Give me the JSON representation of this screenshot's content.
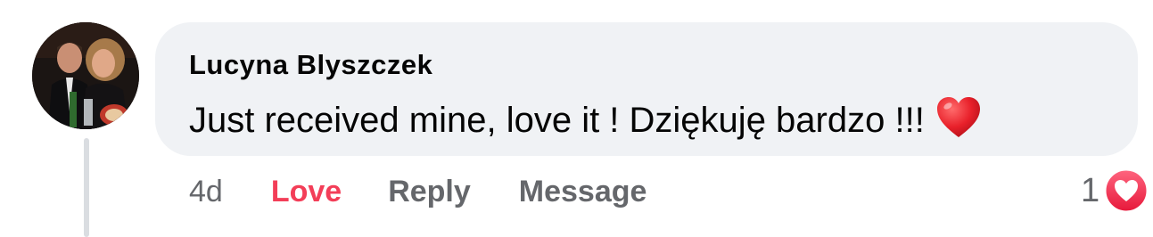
{
  "comment": {
    "author": "Lucyna Blyszczek",
    "text": "Just received mine, love it ! Dziękuję bardzo !!!",
    "emoji": "red-heart-emoji",
    "avatar": "profile-photo"
  },
  "actions": {
    "timestamp": "4d",
    "love_label": "Love",
    "reply_label": "Reply",
    "message_label": "Message"
  },
  "reactions": {
    "count": "1",
    "icon": "love-reaction-icon"
  },
  "colors": {
    "bubble": "#f0f2f5",
    "love": "#f33e58",
    "secondary_text": "#65676b",
    "primary_text": "#050505"
  }
}
